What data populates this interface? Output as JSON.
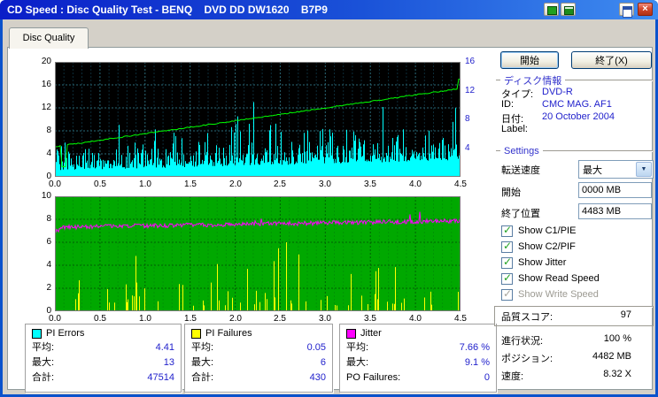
{
  "window": {
    "title": "CD Speed : Disc Quality Test - BENQ    DVD DD DW1620    B7P9"
  },
  "icons": {
    "close": "×",
    "dropdown_arrow": "▼",
    "check": "✓"
  },
  "tab": {
    "label": "Disc Quality"
  },
  "buttons": {
    "start": "開始",
    "exit": "終了(X)"
  },
  "disc_info": {
    "group_label": "ディスク情報",
    "fields": [
      {
        "label": "タイプ:",
        "value": "DVD-R"
      },
      {
        "label": "ID:",
        "value": "CMC MAG. AF1"
      },
      {
        "label": "日付:",
        "value": "20 October 2004"
      },
      {
        "label": "Label:",
        "value": ""
      }
    ]
  },
  "settings": {
    "group_label": "Settings",
    "transfer_speed_label": "転送速度",
    "transfer_speed_value": "最大",
    "start_label": "開始",
    "start_value": "0000 MB",
    "end_label": "終了位置",
    "end_value": "4483 MB",
    "checkboxes": [
      {
        "label": "Show C1/PIE",
        "checked": true,
        "disabled": false
      },
      {
        "label": "Show C2/PIF",
        "checked": true,
        "disabled": false
      },
      {
        "label": "Show Jitter",
        "checked": true,
        "disabled": false
      },
      {
        "label": "Show Read Speed",
        "checked": true,
        "disabled": false
      },
      {
        "label": "Show Write Speed",
        "checked": true,
        "disabled": true
      }
    ]
  },
  "status": {
    "quality_label": "品質スコア:",
    "quality_value": "97",
    "progress_label": "進行状況:",
    "progress_value": "100 %",
    "position_label": "ポジション:",
    "position_value": "4482 MB",
    "speed_label": "速度:",
    "speed_value": "8.32 X"
  },
  "stats": {
    "pi_errors": {
      "title": "PI Errors",
      "swatch": "#00ffff",
      "rows": [
        {
          "label": "平均:",
          "value": "4.41"
        },
        {
          "label": "最大:",
          "value": "13"
        },
        {
          "label": "合計:",
          "value": "47514"
        }
      ]
    },
    "pi_failures": {
      "title": "PI Failures",
      "swatch": "#ffff00",
      "rows": [
        {
          "label": "平均:",
          "value": "0.05"
        },
        {
          "label": "最大:",
          "value": "6"
        },
        {
          "label": "合計:",
          "value": "430"
        }
      ]
    },
    "jitter": {
      "title": "Jitter",
      "swatch": "#ff00ff",
      "rows": [
        {
          "label": "平均:",
          "value": "7.66 %"
        },
        {
          "label": "最大:",
          "value": "9.1 %"
        },
        {
          "label": "PO Failures:",
          "value": "0"
        }
      ]
    }
  },
  "chart_data": [
    {
      "type": "bar",
      "title": "PI Errors with Read Speed overlay",
      "x": {
        "min": 0,
        "max": 4.5,
        "ticks": [
          "0.0",
          "0.5",
          "1.0",
          "1.5",
          "2.0",
          "2.5",
          "3.0",
          "3.5",
          "4.0",
          "4.5"
        ]
      },
      "y_left": {
        "min": 0,
        "max": 20,
        "ticks": [
          20,
          16,
          12,
          8,
          4,
          0
        ],
        "gridlines": [
          4,
          8,
          12,
          16
        ]
      },
      "y_right": {
        "min": 0,
        "max": 16,
        "ticks": [
          16,
          12,
          8,
          4
        ]
      },
      "plot_bg": "#000000",
      "grid": {
        "minor": "#0c2c38",
        "major": "#2a6a78"
      },
      "series": [
        {
          "name": "PI Errors",
          "type": "bar",
          "color": "#00ffff",
          "axis": "left",
          "average": 4.41,
          "max": 13,
          "total": 47514
        },
        {
          "name": "Read Speed",
          "type": "line",
          "color": "#00ff00",
          "axis": "right",
          "start": 4.2,
          "end": 12.3,
          "end_spike": 13.6,
          "dip": {
            "x": 0.1,
            "value": 1.4
          },
          "final_speed": "8.32 X"
        }
      ]
    },
    {
      "type": "line",
      "title": "Jitter with PI Failures",
      "x": {
        "min": 0,
        "max": 4.5,
        "ticks": [
          "0.0",
          "0.5",
          "1.0",
          "1.5",
          "2.0",
          "2.5",
          "3.0",
          "3.5",
          "4.0",
          "4.5"
        ]
      },
      "y_left": {
        "min": 0,
        "max": 10,
        "ticks": [
          10,
          8,
          6,
          4,
          2,
          0
        ],
        "gridlines": [
          2,
          4,
          6,
          8
        ]
      },
      "plot_bg": "#00a800",
      "grid": {
        "minor": "#009404",
        "major": "#006004"
      },
      "series": [
        {
          "name": "Jitter",
          "type": "line",
          "color": "#ff00ff",
          "axis": "left",
          "average": 7.66,
          "max": 9.1,
          "unit": "%"
        },
        {
          "name": "PI Failures",
          "type": "bar",
          "color": "#ffff00",
          "axis": "left",
          "average": 0.05,
          "max": 6,
          "total": 430
        }
      ]
    }
  ]
}
